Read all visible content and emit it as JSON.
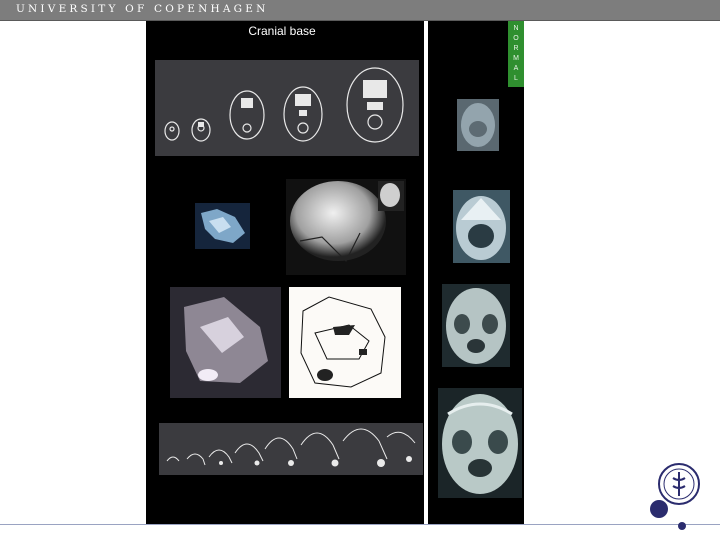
{
  "header": {
    "institution": "UNIVERSITY OF COPENHAGEN"
  },
  "slide": {
    "title": "Cranial base"
  },
  "tag": {
    "letters": [
      "N",
      "O",
      "R",
      "M",
      "A",
      "L"
    ]
  },
  "colors": {
    "header_bg": "#7d7d7d",
    "panel_bg": "#000000",
    "tag_green": "#2f8f2f",
    "brand_navy": "#2b2c6e"
  },
  "figures": [
    "axial-skull-tracings-series",
    "lateral-cranial-base-photo",
    "lateral-skull-xray",
    "sagittal-skull-section-photo",
    "sagittal-skull-tracing",
    "sagittal-tracings-growth-series",
    "axial-xray-1",
    "axial-xray-2",
    "axial-xray-3",
    "axial-xray-4"
  ],
  "logo": {
    "icon": "university-seal-icon"
  }
}
